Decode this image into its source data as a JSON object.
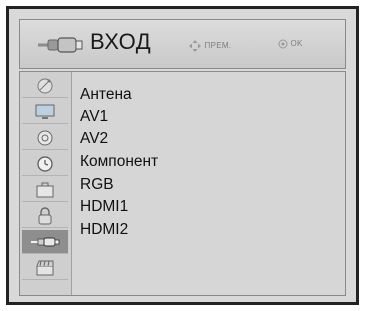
{
  "header": {
    "title": "ВХОД",
    "icon": "cable-plug-icon",
    "hint_move": "ПРЕМ.",
    "hint_ok": "OK"
  },
  "sidebar": [
    {
      "icon": "satellite-dish-icon",
      "active": false
    },
    {
      "icon": "tv-monitor-icon",
      "active": false
    },
    {
      "icon": "speaker-icon",
      "active": false
    },
    {
      "icon": "clock-icon",
      "active": false
    },
    {
      "icon": "briefcase-icon",
      "active": false
    },
    {
      "icon": "lock-icon",
      "active": false
    },
    {
      "icon": "cable-plug-icon",
      "active": true
    },
    {
      "icon": "film-clapper-icon",
      "active": false
    }
  ],
  "inputs": [
    "Антена",
    "AV1",
    "AV2",
    "Компонент",
    "RGB",
    "HDMI1",
    "HDMI2"
  ],
  "colors": {
    "frame": "#232323",
    "panel": "#d9d9d9",
    "active_tab": "#8e8e8e"
  }
}
